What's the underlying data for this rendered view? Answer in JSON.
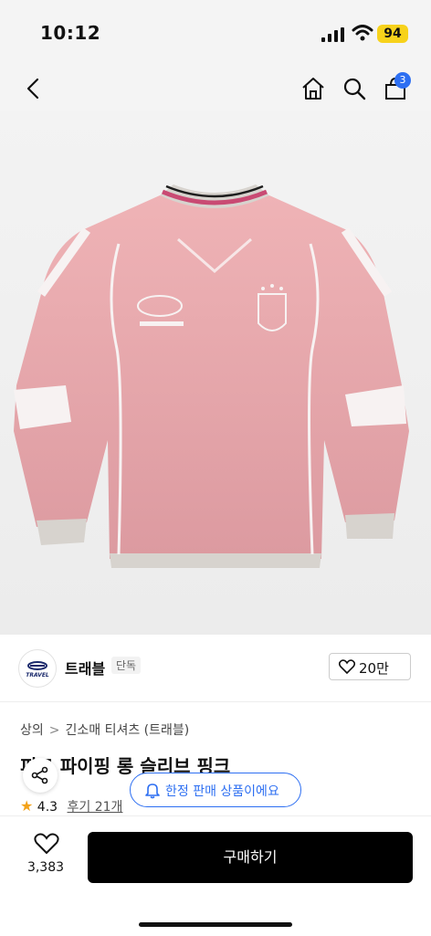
{
  "status": {
    "time": "10:12",
    "battery": "94"
  },
  "nav": {
    "cart_badge": "3"
  },
  "brand": {
    "logo_text": "TRAVEL",
    "name": "트래블",
    "badge": "단독",
    "likes": "20만"
  },
  "breadcrumb": {
    "root": "상의",
    "sep": ">",
    "category": "긴소매 티셔츠 (트래블)"
  },
  "product": {
    "title": "피그 파이핑 롱 슬리브 핑크",
    "rating": "4.3",
    "reviews": "후기 21개"
  },
  "banner": {
    "limited": "한정 판매 상품이에요"
  },
  "bottom": {
    "wish_count": "3,383",
    "buy_label": "구매하기"
  },
  "colors": {
    "accent": "#2d6ff2",
    "star": "#f3a21a",
    "shirt": "#e8a9ae",
    "buy_bg": "#000000"
  }
}
